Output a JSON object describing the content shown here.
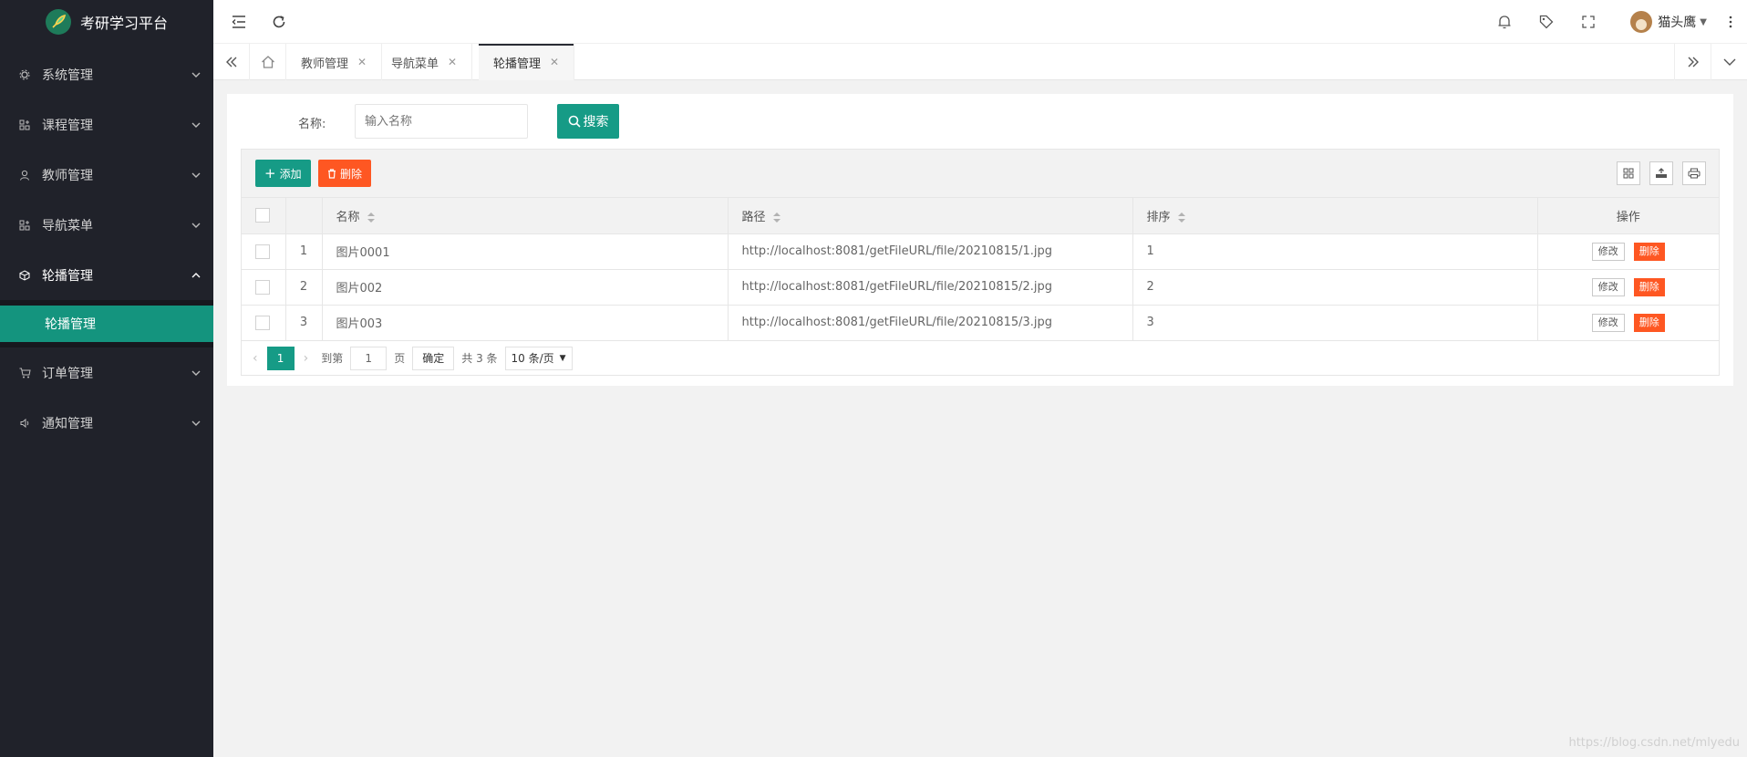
{
  "app": {
    "title": "考研学习平台"
  },
  "sidebar": {
    "items": [
      {
        "label": "系统管理",
        "icon": "gear-icon"
      },
      {
        "label": "课程管理",
        "icon": "apps-icon"
      },
      {
        "label": "教师管理",
        "icon": "user-icon"
      },
      {
        "label": "导航菜单",
        "icon": "apps-icon"
      },
      {
        "label": "轮播管理",
        "icon": "cube-icon"
      },
      {
        "label": "订单管理",
        "icon": "cart-icon"
      },
      {
        "label": "通知管理",
        "icon": "speaker-icon"
      }
    ],
    "open_sub": {
      "label": "轮播管理"
    }
  },
  "header": {
    "username": "猫头鹰"
  },
  "tabs": [
    {
      "label": "教师管理"
    },
    {
      "label": "导航菜单"
    },
    {
      "label": "轮播管理"
    }
  ],
  "search": {
    "label": "名称:",
    "placeholder": "输入名称",
    "button": "搜索"
  },
  "toolbar": {
    "add": "添加",
    "delete": "删除"
  },
  "table": {
    "columns": [
      "名称",
      "路径",
      "排序",
      "操作"
    ],
    "rows": [
      {
        "idx": "1",
        "name": "图片0001",
        "path": "http://localhost:8081/getFileURL/file/20210815/1.jpg",
        "order": "1"
      },
      {
        "idx": "2",
        "name": "图片002",
        "path": "http://localhost:8081/getFileURL/file/20210815/2.jpg",
        "order": "2"
      },
      {
        "idx": "3",
        "name": "图片003",
        "path": "http://localhost:8081/getFileURL/file/20210815/3.jpg",
        "order": "3"
      }
    ],
    "edit_label": "修改",
    "delete_label": "删除"
  },
  "pager": {
    "current": "1",
    "goto_label": "到第",
    "page_input": "1",
    "page_unit": "页",
    "confirm": "确定",
    "total": "共 3 条",
    "per_page": "10 条/页"
  },
  "watermark": "https://blog.csdn.net/mlyedu",
  "colors": {
    "sidebar_bg": "#20222a",
    "accent": "#169b86",
    "danger": "#fe5722"
  }
}
